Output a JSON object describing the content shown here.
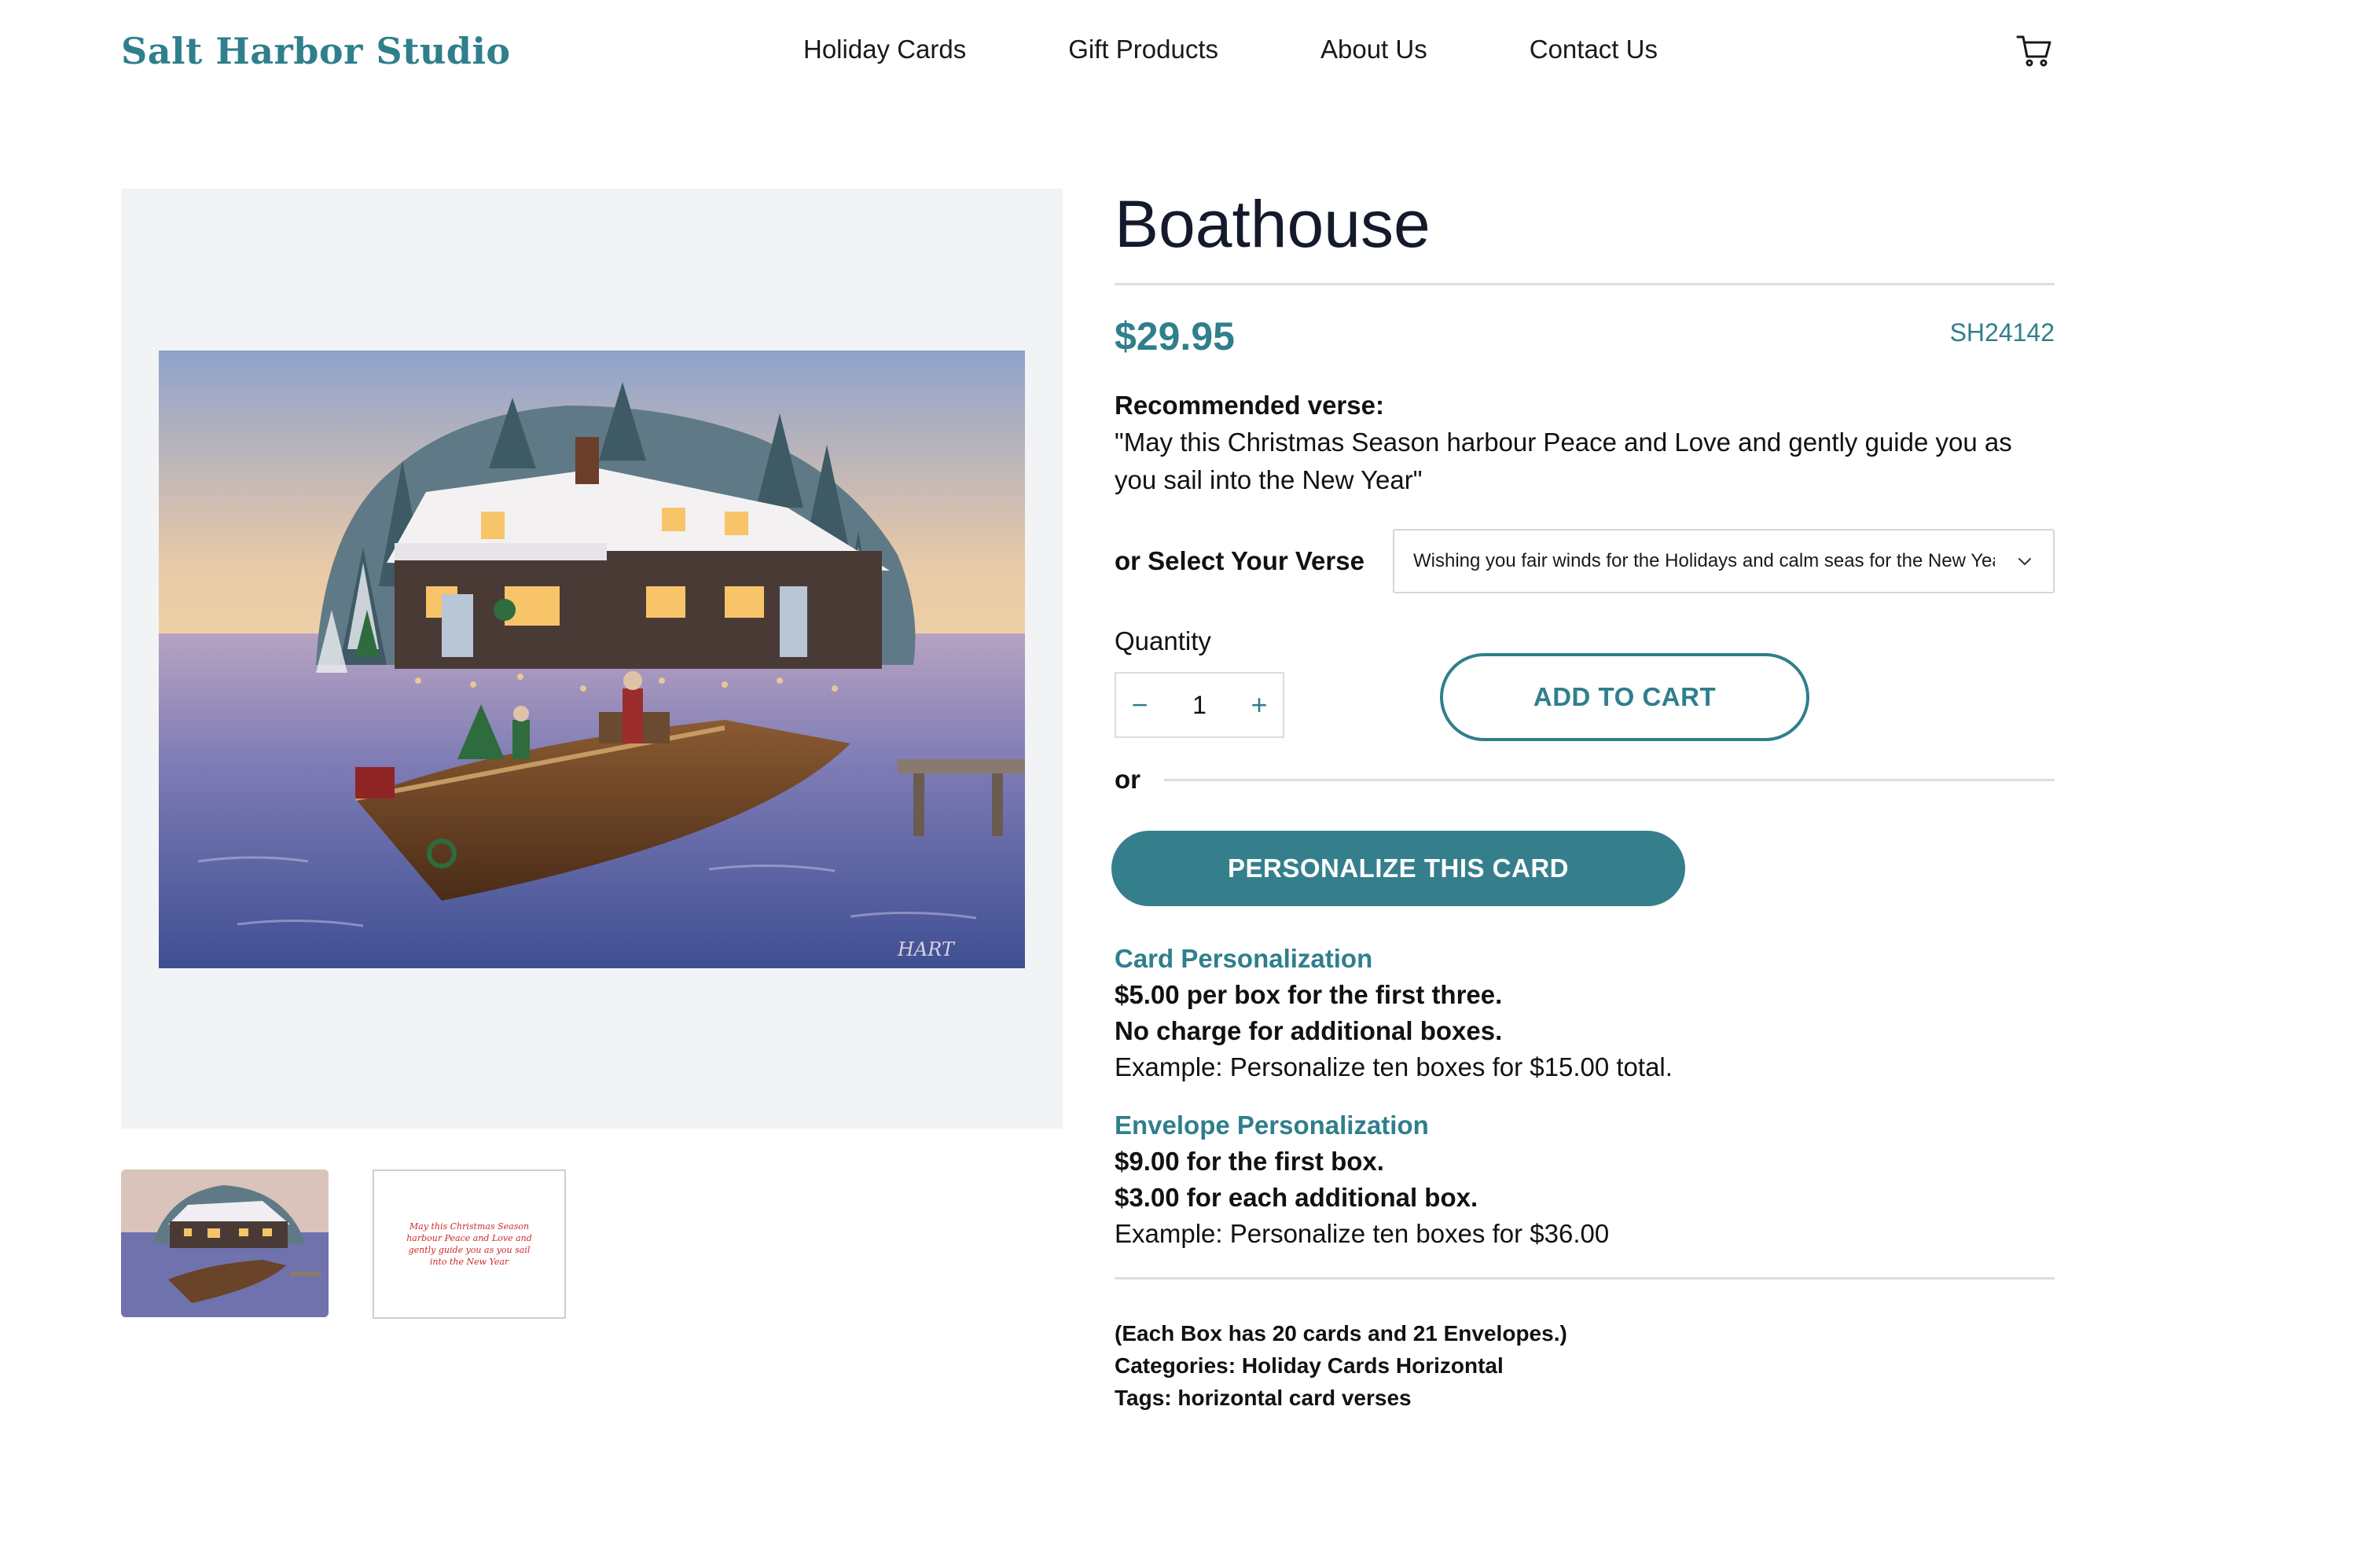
{
  "header": {
    "logo": "Salt Harbor Studio",
    "nav": [
      "Holiday Cards",
      "Gift Products",
      "About Us",
      "Contact Us"
    ],
    "cart_icon": "shopping-cart-icon"
  },
  "product": {
    "title": "Boathouse",
    "price": "$29.95",
    "sku": "SH24142",
    "recommended_label": "Recommended verse:",
    "recommended_verse": "\"May this Christmas Season harbour Peace and Love and gently guide you as you sail into the New Year\"",
    "select_label": "or Select Your Verse",
    "select_value": "Wishing you fair winds for the Holidays and calm seas for the New Year",
    "quantity_label": "Quantity",
    "quantity": "1",
    "minus": "−",
    "plus": "+",
    "add_to_cart": "ADD TO CART",
    "or": "or",
    "personalize": "PERSONALIZE THIS CARD",
    "thumb_verse": "May this Christmas Season harbour Peace and Love and gently guide you as you sail into the New Year"
  },
  "card_personalization": {
    "heading": "Card Personalization",
    "line1": "$5.00 per box for the first three.",
    "line2": "No charge for additional boxes.",
    "example": "Example: Personalize ten boxes for $15.00 total."
  },
  "envelope_personalization": {
    "heading": "Envelope Personalization",
    "line1": "$9.00 for the first box.",
    "line2": "$3.00 for each additional box.",
    "example": "Example: Personalize ten boxes for $36.00"
  },
  "meta": {
    "box_note": "(Each Box has 20 cards and 21 Envelopes.)",
    "categories": "Categories: Holiday Cards Horizontal",
    "tags": "Tags: horizontal card verses"
  },
  "colors": {
    "accent": "#2f7f8c",
    "button_fill": "#357f8d",
    "image_bg": "#f2f3f5"
  }
}
